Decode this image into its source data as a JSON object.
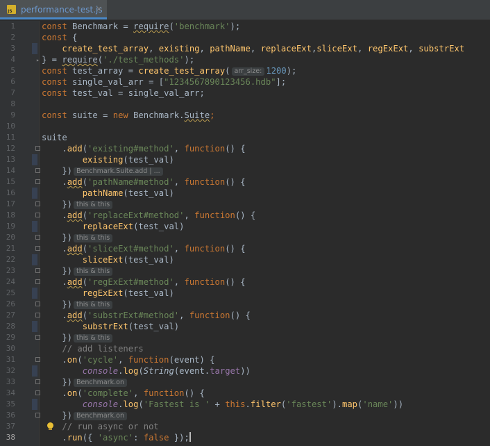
{
  "tab": {
    "label": "performance-test.js",
    "close": "×",
    "icon_text": "JS"
  },
  "hints": {
    "arr_size": "arr_size:",
    "bench_add": "Benchmark.Suite.add | ...",
    "this_this": "this & this",
    "bench_on": "Benchmark.on"
  },
  "lines": [
    {
      "n": "1"
    },
    {
      "n": "2"
    },
    {
      "n": "3"
    },
    {
      "n": "4"
    },
    {
      "n": "5"
    },
    {
      "n": "6"
    },
    {
      "n": "7"
    },
    {
      "n": "8"
    },
    {
      "n": "9"
    },
    {
      "n": "10"
    },
    {
      "n": "11"
    },
    {
      "n": "12"
    },
    {
      "n": "13"
    },
    {
      "n": "14"
    },
    {
      "n": "15"
    },
    {
      "n": "16"
    },
    {
      "n": "17"
    },
    {
      "n": "18"
    },
    {
      "n": "19"
    },
    {
      "n": "20"
    },
    {
      "n": "21"
    },
    {
      "n": "22"
    },
    {
      "n": "23"
    },
    {
      "n": "24"
    },
    {
      "n": "25"
    },
    {
      "n": "26"
    },
    {
      "n": "27"
    },
    {
      "n": "28"
    },
    {
      "n": "29"
    },
    {
      "n": "30"
    },
    {
      "n": "31"
    },
    {
      "n": "32"
    },
    {
      "n": "33"
    },
    {
      "n": "34"
    },
    {
      "n": "35"
    },
    {
      "n": "36"
    },
    {
      "n": "37"
    },
    {
      "n": "38"
    }
  ],
  "code": {
    "l1": [
      "const",
      " Benchmark",
      " = ",
      "require",
      "(",
      "'benchmark'",
      ");"
    ],
    "l2": [
      "const",
      " {"
    ],
    "l3": [
      "    ",
      "create_test_array",
      ", ",
      "existing",
      ", ",
      "pathName",
      ", ",
      "replaceExt",
      ",",
      "sliceExt",
      ", ",
      "regExExt",
      ", ",
      "substrExt"
    ],
    "l4": [
      "} = ",
      "require",
      "(",
      "'./test_methods'",
      ");"
    ],
    "l5": [
      "const",
      " test_array = ",
      "create_test_array",
      "(",
      " ",
      "1200",
      ");"
    ],
    "l6": [
      "const",
      " single_val_arr = [",
      "\"1234567890123456.hdb\"",
      "];"
    ],
    "l7": [
      "const",
      " test_val = single_val_arr;"
    ],
    "l9": [
      "const",
      " suite = ",
      "new",
      " Benchmark.",
      "Suite",
      ";"
    ],
    "l12": [
      "suite"
    ],
    "l13": [
      "    .",
      "add",
      "(",
      "'existing#method'",
      ", ",
      "function",
      "() {"
    ],
    "l14": [
      "        ",
      "existing",
      "(test_val)"
    ],
    "l15": [
      "    })"
    ],
    "l16": [
      "    .",
      "add",
      "(",
      "'pathName#method'",
      ", ",
      "function",
      "() {"
    ],
    "l17": [
      "        ",
      "pathName",
      "(test_val)"
    ],
    "l18": [
      "    })"
    ],
    "l19": [
      "    .",
      "add",
      "(",
      "'replaceExt#method'",
      ", ",
      "function",
      "() {"
    ],
    "l20": [
      "        ",
      "replaceExt",
      "(test_val)"
    ],
    "l21": [
      "    })"
    ],
    "l22": [
      "    .",
      "add",
      "(",
      "'sliceExt#method'",
      ", ",
      "function",
      "() {"
    ],
    "l23": [
      "        ",
      "sliceExt",
      "(test_val)"
    ],
    "l24": [
      "    })"
    ],
    "l25": [
      "    .",
      "add",
      "(",
      "'regExExt#method'",
      ", ",
      "function",
      "() {"
    ],
    "l26": [
      "        ",
      "regExExt",
      "(test_val)"
    ],
    "l27": [
      "    })"
    ],
    "l28": [
      "    .",
      "add",
      "(",
      "'substrExt#method'",
      ", ",
      "function",
      "() {"
    ],
    "l29": [
      "        ",
      "substrExt",
      "(test_val)"
    ],
    "l30": [
      "    })"
    ],
    "l31": [
      "    ",
      "// add listeners"
    ],
    "l32": [
      "    .",
      "on",
      "(",
      "'cycle'",
      ", ",
      "function",
      "(event) {"
    ],
    "l33": [
      "        ",
      "console",
      ".",
      "log",
      "(",
      "String",
      "(event.",
      "target",
      "))"
    ],
    "l34": [
      "    })"
    ],
    "l35": [
      "    .",
      "on",
      "(",
      "'complete'",
      ", ",
      "function",
      "() {"
    ],
    "l36": [
      "        ",
      "console",
      ".",
      "log",
      "(",
      "'Fastest is '",
      " + ",
      "this",
      ".",
      "filter",
      "(",
      "'fastest'",
      ").",
      "map",
      "(",
      "'name'",
      "))"
    ],
    "l37": [
      "    })"
    ],
    "l38": [
      "    ",
      "// run async or not"
    ],
    "l39": [
      "    .",
      "run",
      "({ ",
      "'async'",
      ": ",
      "false",
      " });"
    ]
  },
  "colors": {
    "keyword": "#cc7832",
    "string": "#6a8759",
    "function": "#ffc66d",
    "number": "#6897bb",
    "comment": "#808080",
    "background": "#2b2b2b"
  }
}
